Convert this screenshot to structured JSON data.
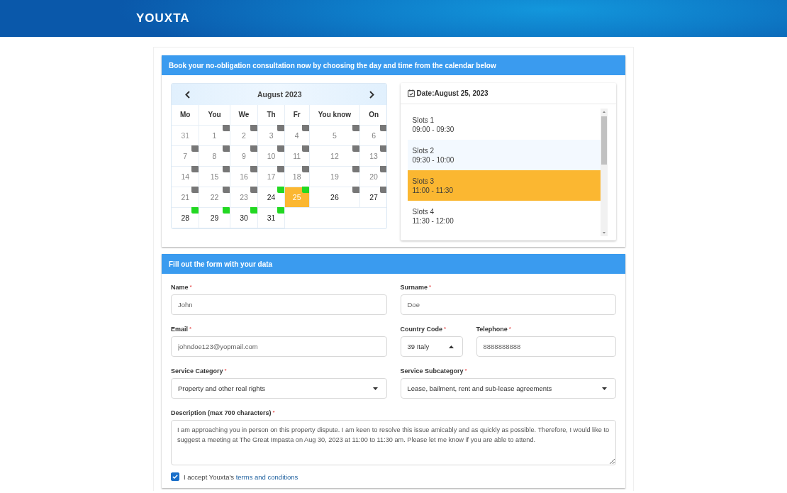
{
  "header": {
    "logo": "YOUXTA"
  },
  "booking": {
    "title": "Book your no-obligation consultation now by choosing the day and time from the calendar below",
    "calendar": {
      "month": "August 2023",
      "weekdays": [
        "Mo",
        "You",
        "We",
        "Th",
        "Fr",
        "You know",
        "On"
      ],
      "weeks": [
        [
          {
            "day": "31",
            "other_month": true,
            "disabled": true,
            "selected": false
          },
          {
            "day": "1",
            "other_month": false,
            "disabled": true,
            "selected": false,
            "color": "#777777"
          },
          {
            "day": "2",
            "other_month": false,
            "disabled": true,
            "selected": false,
            "color": "#777777"
          },
          {
            "day": "3",
            "other_month": false,
            "disabled": true,
            "selected": false,
            "color": "#777777"
          },
          {
            "day": "4",
            "other_month": false,
            "disabled": true,
            "selected": false,
            "color": "#777777"
          },
          {
            "day": "5",
            "other_month": false,
            "disabled": true,
            "selected": false,
            "color": "#777777"
          },
          {
            "day": "6",
            "other_month": false,
            "disabled": true,
            "selected": false,
            "color": "#777777"
          }
        ],
        [
          {
            "day": "7",
            "other_month": false,
            "disabled": true,
            "selected": false,
            "color": "#777777"
          },
          {
            "day": "8",
            "other_month": false,
            "disabled": true,
            "selected": false,
            "color": "#777777"
          },
          {
            "day": "9",
            "other_month": false,
            "disabled": true,
            "selected": false,
            "color": "#777777"
          },
          {
            "day": "10",
            "other_month": false,
            "disabled": true,
            "selected": false,
            "color": "#777777"
          },
          {
            "day": "11",
            "other_month": false,
            "disabled": true,
            "selected": false,
            "color": "#777777"
          },
          {
            "day": "12",
            "other_month": false,
            "disabled": true,
            "selected": false,
            "color": "#777777"
          },
          {
            "day": "13",
            "other_month": false,
            "disabled": true,
            "selected": false,
            "color": "#777777"
          }
        ],
        [
          {
            "day": "14",
            "other_month": false,
            "disabled": true,
            "selected": false,
            "color": "#777777"
          },
          {
            "day": "15",
            "other_month": false,
            "disabled": true,
            "selected": false,
            "color": "#777777"
          },
          {
            "day": "16",
            "other_month": false,
            "disabled": true,
            "selected": false,
            "color": "#777777"
          },
          {
            "day": "17",
            "other_month": false,
            "disabled": true,
            "selected": false,
            "color": "#777777"
          },
          {
            "day": "18",
            "other_month": false,
            "disabled": true,
            "selected": false,
            "color": "#777777"
          },
          {
            "day": "19",
            "other_month": false,
            "disabled": true,
            "selected": false,
            "color": "#777777"
          },
          {
            "day": "20",
            "other_month": false,
            "disabled": true,
            "selected": false,
            "color": "#777777"
          }
        ],
        [
          {
            "day": "21",
            "other_month": false,
            "disabled": true,
            "selected": false,
            "color": "#777777"
          },
          {
            "day": "22",
            "other_month": false,
            "disabled": true,
            "selected": false,
            "color": "#777777"
          },
          {
            "day": "23",
            "other_month": false,
            "disabled": true,
            "selected": false,
            "color": "#777777"
          },
          {
            "day": "24",
            "other_month": false,
            "disabled": false,
            "selected": false,
            "color": "#22d822"
          },
          {
            "day": "25",
            "other_month": false,
            "disabled": false,
            "selected": true,
            "color": "#22d822"
          },
          {
            "day": "26",
            "other_month": false,
            "disabled": false,
            "selected": false,
            "color": "#777777"
          },
          {
            "day": "27",
            "other_month": false,
            "disabled": false,
            "selected": false,
            "color": "#777777"
          }
        ],
        [
          {
            "day": "28",
            "other_month": false,
            "disabled": false,
            "selected": false,
            "color": "#22d822"
          },
          {
            "day": "29",
            "other_month": false,
            "disabled": false,
            "selected": false,
            "color": "#22d822"
          },
          {
            "day": "30",
            "other_month": false,
            "disabled": false,
            "selected": false,
            "color": "#22d822"
          },
          {
            "day": "31",
            "other_month": false,
            "disabled": false,
            "selected": false,
            "color": "#22d822"
          }
        ]
      ]
    },
    "slots_panel": {
      "date": "Date:August 25, 2023",
      "slots": [
        {
          "name": "Slots 1",
          "time": "09:00 - 09:30",
          "selected": false,
          "hovered": false
        },
        {
          "name": "Slots 2",
          "time": "09:30 - 10:00",
          "selected": false,
          "hovered": true
        },
        {
          "name": "Slots 3",
          "time": "11:00 - 11:30",
          "selected": true,
          "hovered": false
        },
        {
          "name": "Slots 4",
          "time": "11:30 - 12:00",
          "selected": false,
          "hovered": false
        }
      ]
    }
  },
  "form": {
    "title": "Fill out the form with your data",
    "rows": [
      {
        "columns": [
          [
            {
              "kind": "text",
              "label": "Name",
              "required_mark": "*",
              "value": "John"
            }
          ],
          [
            {
              "kind": "text",
              "label": "Surname",
              "required_mark": "*",
              "value": "Doe"
            }
          ]
        ]
      },
      {
        "columns": [
          [
            {
              "kind": "text",
              "label": "Email",
              "required_mark": "*",
              "value": "johndoe123@yopmail.com"
            }
          ],
          [
            {
              "kind": "select",
              "label": "Country Code",
              "required_mark": "*",
              "value": "39 Italy",
              "expanded": true
            },
            {
              "kind": "text",
              "label": "Telephone",
              "required_mark": "*",
              "value": "8888888888"
            }
          ]
        ]
      },
      {
        "columns": [
          [
            {
              "kind": "select",
              "label": "Service Category",
              "required_mark": "*",
              "value": "Property and other real rights",
              "expanded": false
            }
          ],
          [
            {
              "kind": "select",
              "label": "Service Subcategory",
              "required_mark": "*",
              "value": "Lease, bailment, rent and sub-lease agreements",
              "expanded": false
            }
          ]
        ]
      },
      {
        "columns": [
          [
            {
              "kind": "textarea",
              "label": "Description (max 700 characters)",
              "required_mark": "*",
              "value": "I am approaching you in person on this property dispute. I am keen to resolve this issue amicably and as quickly as possible. Therefore, I would like to suggest a meeting at The Great Impasta on Aug 30, 2023 at 11:00 to 11:30 am. Please let me know if you are able to attend."
            }
          ]
        ]
      }
    ],
    "consent": {
      "checked": true,
      "text": "I accept Youxta's",
      "link": "terms and conditions"
    }
  }
}
